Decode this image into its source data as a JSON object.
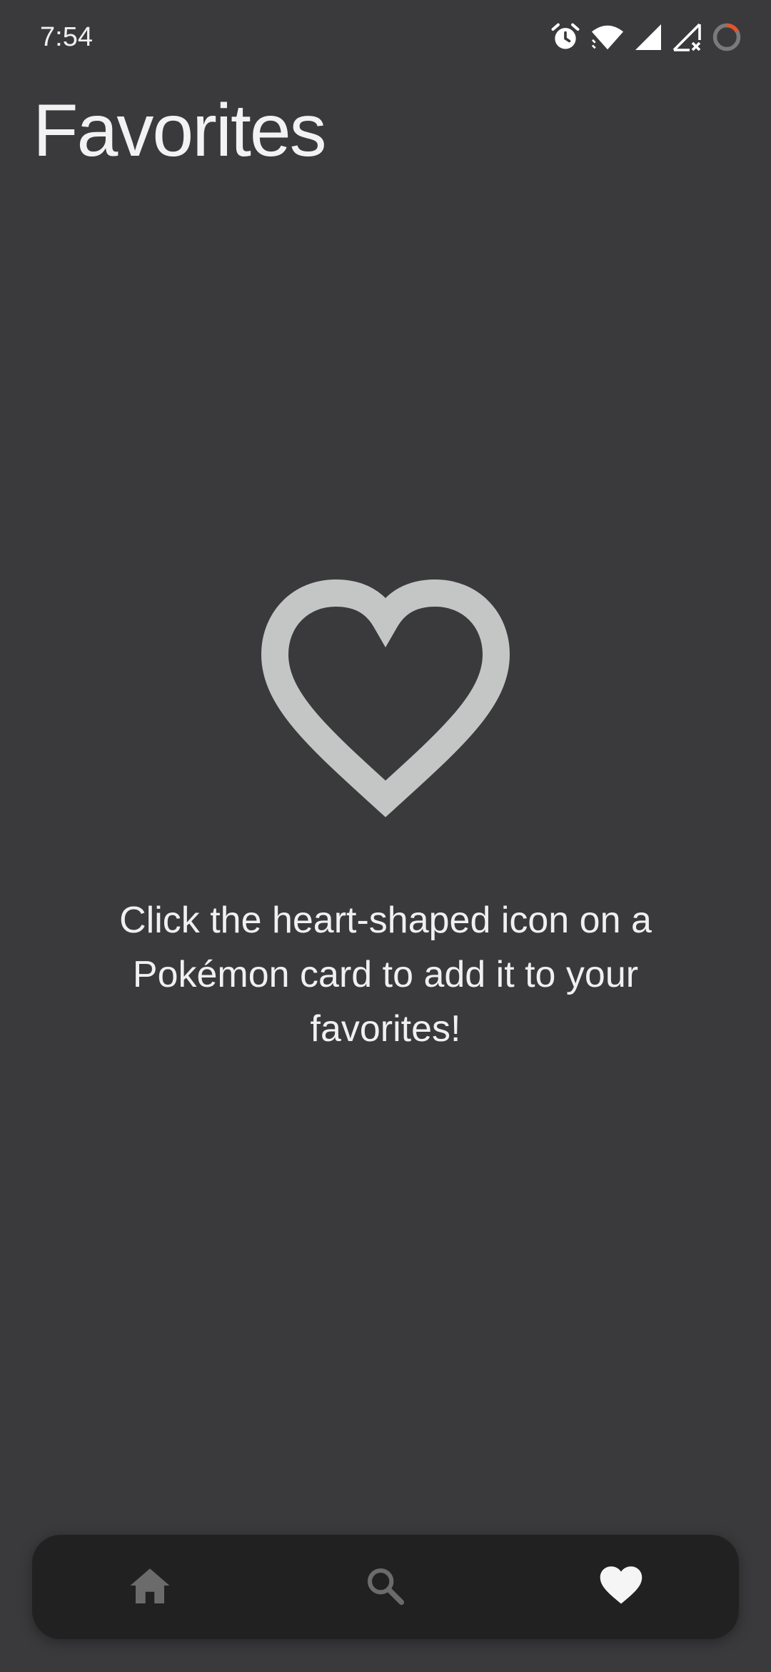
{
  "status_bar": {
    "time": "7:54",
    "icons": [
      "alarm-icon",
      "wifi-icon",
      "signal-icon",
      "no-signal-icon",
      "loading-ring-icon"
    ]
  },
  "page": {
    "title": "Favorites"
  },
  "empty_state": {
    "icon": "heart-outline-icon",
    "message": "Click the heart-shaped icon on a Pokémon card to add it to your favorites!"
  },
  "bottom_nav": {
    "items": [
      {
        "icon": "home-icon",
        "active": false
      },
      {
        "icon": "search-icon",
        "active": false
      },
      {
        "icon": "heart-icon",
        "active": true
      }
    ]
  },
  "colors": {
    "background": "#3a3a3c",
    "nav_background": "#212121",
    "heart_outline": "#c4c6c5",
    "nav_inactive": "#6b6b6b",
    "nav_active": "#f5f5f5",
    "loading_accent": "#e5532b"
  }
}
